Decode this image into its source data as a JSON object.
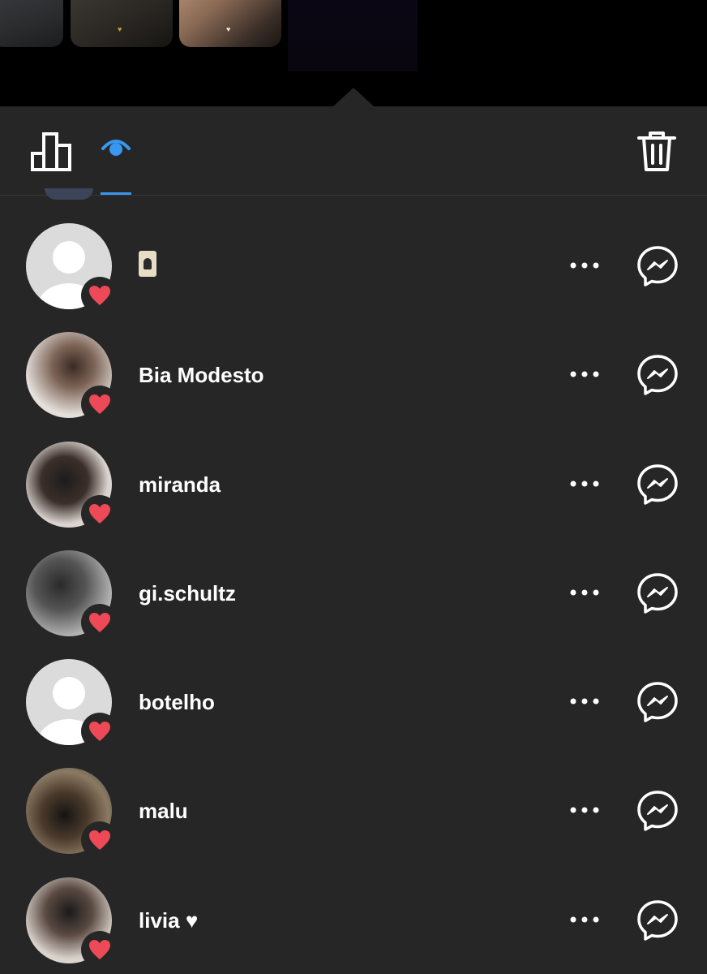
{
  "tabs": [
    {
      "name": "insights",
      "icon": "bar-chart-icon",
      "active": false
    },
    {
      "name": "viewers",
      "icon": "eye-icon",
      "active": true
    }
  ],
  "accent_color": "#3897f0",
  "like_color": "#ed4956",
  "delete_icon": "trash-icon",
  "viewers": [
    {
      "username": "",
      "avatar": "default-avatar",
      "liked": true,
      "name_icon": "playing-card-icon"
    },
    {
      "username": "Bia Modesto",
      "avatar": "photo",
      "liked": true
    },
    {
      "username": "miranda",
      "avatar": "photo",
      "liked": true
    },
    {
      "username": "gi.schultz",
      "avatar": "photo",
      "liked": true
    },
    {
      "username": "botelho",
      "avatar": "default-avatar",
      "liked": true
    },
    {
      "username": "malu",
      "avatar": "photo",
      "liked": true
    },
    {
      "username": "livia ♥",
      "avatar": "photo",
      "liked": true
    }
  ]
}
